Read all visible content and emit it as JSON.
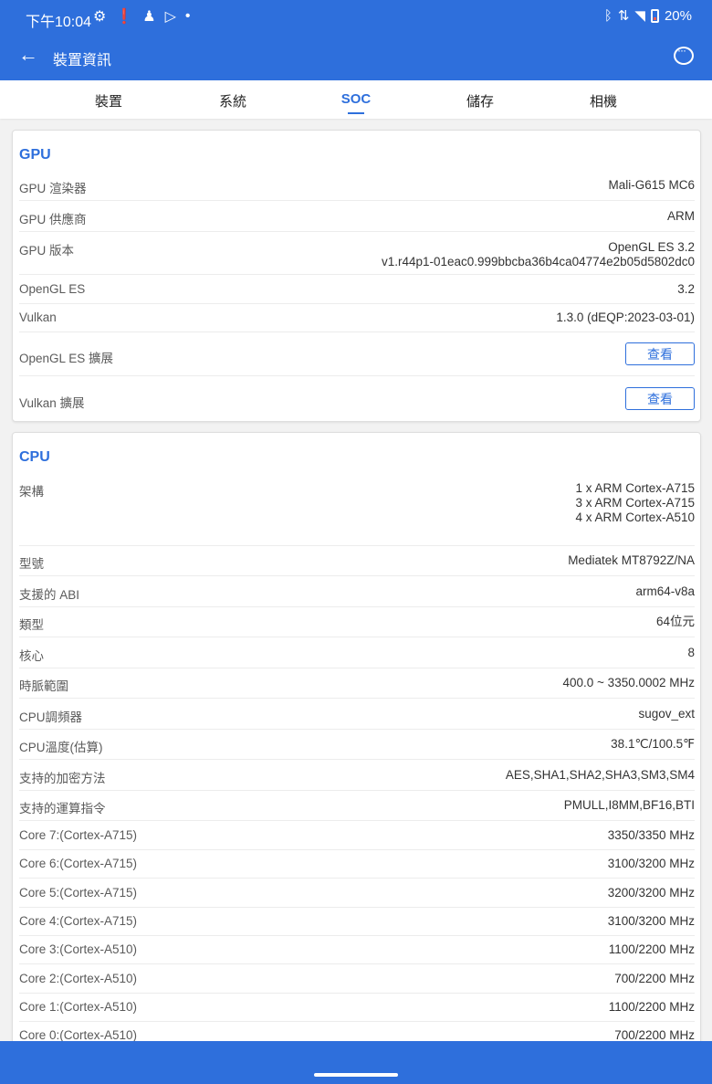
{
  "status_bar": {
    "time": "下午10:04",
    "battery": "20%"
  },
  "toolbar": {
    "title": "裝置資訊"
  },
  "tabs": [
    {
      "label": "裝置"
    },
    {
      "label": "系統"
    },
    {
      "label": "SOC"
    },
    {
      "label": "儲存"
    },
    {
      "label": "相機"
    }
  ],
  "gpu": {
    "title": "GPU",
    "rows": [
      {
        "label": "GPU 渲染器",
        "value": "Mali-G615 MC6"
      },
      {
        "label": "GPU 供應商",
        "value": "ARM"
      },
      {
        "label": "GPU 版本",
        "value": "OpenGL ES 3.2\nv1.r44p1-01eac0.999bbcba36b4ca04774e2b05d5802dc0"
      },
      {
        "label": "OpenGL ES",
        "value": "3.2"
      },
      {
        "label": "Vulkan",
        "value": "1.3.0 (dEQP:2023-03-01)"
      }
    ],
    "ext_rows": [
      {
        "label": "OpenGL ES 擴展",
        "button": "查看"
      },
      {
        "label": "Vulkan 擴展",
        "button": "查看"
      }
    ]
  },
  "cpu": {
    "title": "CPU",
    "rows": [
      {
        "label": "架構",
        "value": "1 x ARM Cortex-A715\n3 x ARM Cortex-A715\n4 x ARM Cortex-A510"
      },
      {
        "label": "型號",
        "value": "Mediatek MT8792Z/NA"
      },
      {
        "label": "支援的 ABI",
        "value": "arm64-v8a"
      },
      {
        "label": "類型",
        "value": "64位元"
      },
      {
        "label": "核心",
        "value": "8"
      },
      {
        "label": "時脈範圍",
        "value": "400.0 ~ 3350.0002 MHz"
      },
      {
        "label": "CPU調頻器",
        "value": "sugov_ext"
      },
      {
        "label": "CPU溫度(估算)",
        "value": "38.1℃/100.5℉"
      },
      {
        "label": "支持的加密方法",
        "value": "AES,SHA1,SHA2,SHA3,SM3,SM4"
      },
      {
        "label": "支持的運算指令",
        "value": "PMULL,I8MM,BF16,BTI"
      },
      {
        "label": "Core 7:(Cortex-A715)",
        "value": "3350/3350 MHz"
      },
      {
        "label": "Core 6:(Cortex-A715)",
        "value": "3100/3200 MHz"
      },
      {
        "label": "Core 5:(Cortex-A715)",
        "value": "3200/3200 MHz"
      },
      {
        "label": "Core 4:(Cortex-A715)",
        "value": "3100/3200 MHz"
      },
      {
        "label": "Core 3:(Cortex-A510)",
        "value": "1100/2200 MHz"
      },
      {
        "label": "Core 2:(Cortex-A510)",
        "value": "700/2200 MHz"
      },
      {
        "label": "Core 1:(Cortex-A510)",
        "value": "1100/2200 MHz"
      },
      {
        "label": "Core 0:(Cortex-A510)",
        "value": "700/2200 MHz"
      }
    ]
  }
}
